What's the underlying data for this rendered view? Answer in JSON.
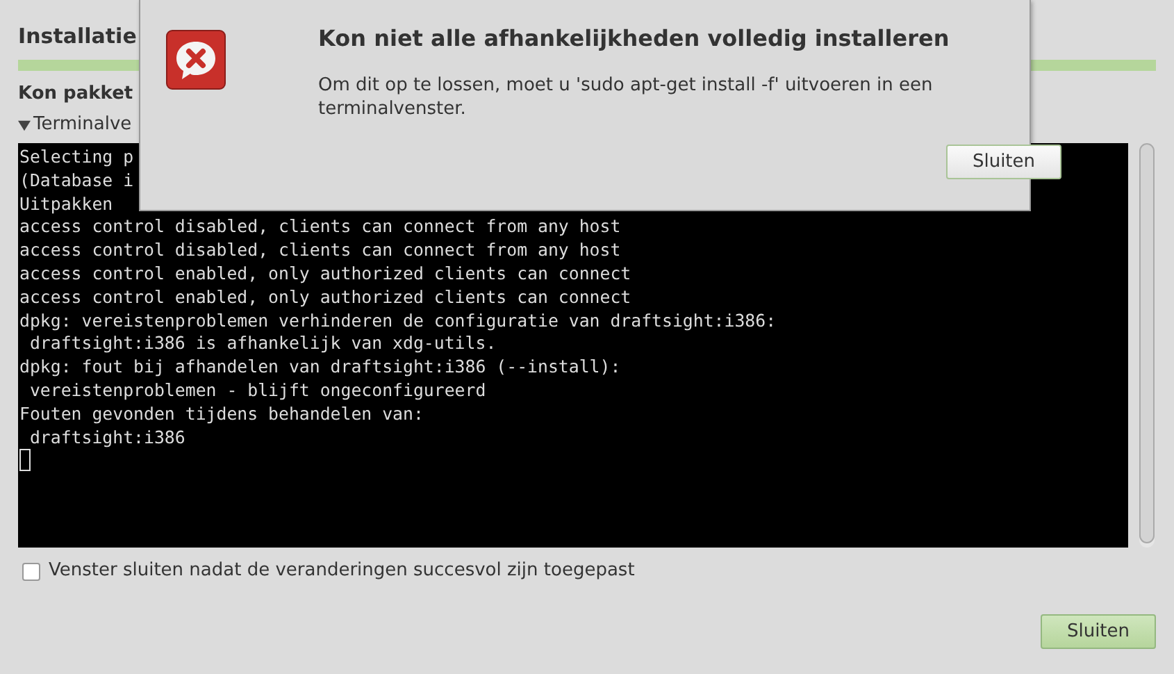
{
  "window": {
    "title": "Installatie",
    "progress": {
      "level": 1.0
    },
    "subtitle": "Kon pakket",
    "expander": {
      "label": "Terminalve",
      "expanded": true
    }
  },
  "terminal": {
    "lines": [
      "Selecting p",
      "(Database i",
      "Uitpakken",
      "access control disabled, clients can connect from any host",
      "access control disabled, clients can connect from any host",
      "access control enabled, only authorized clients can connect",
      "access control enabled, only authorized clients can connect",
      "dpkg: vereistenproblemen verhinderen de configuratie van draftsight:i386:",
      " draftsight:i386 is afhankelijk van xdg-utils.",
      "dpkg: fout bij afhandelen van draftsight:i386 (--install):",
      " vereistenproblemen - blijft ongeconfigureerd",
      "Fouten gevonden tijdens behandelen van:",
      " draftsight:i386"
    ],
    "cursor": true
  },
  "close_checkbox": {
    "label": "Venster sluiten nadat de veranderingen succesvol zijn toegepast",
    "checked": false
  },
  "close_button": "Sluiten",
  "dialog": {
    "title": "Kon niet alle afhankelijkheden volledig installeren",
    "message": "Om dit op te lossen, moet u 'sudo apt-get install -f' uitvoeren in een terminalvenster.",
    "button": "Sluiten"
  }
}
